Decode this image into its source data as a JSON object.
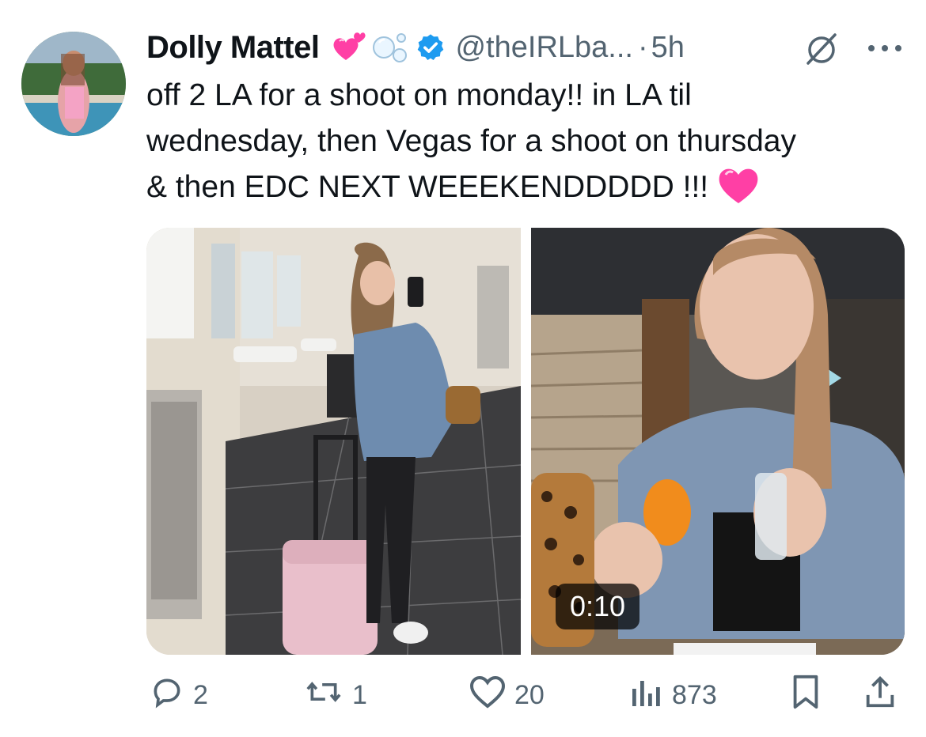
{
  "tweet": {
    "author": {
      "display_name": "Dolly Mattel",
      "handle": "@theIRLba...",
      "verified": true,
      "name_emojis": [
        "two-hearts-emoji",
        "bubbles-emoji"
      ]
    },
    "separator": "·",
    "time": "5h",
    "text_lines": [
      "off 2 LA for a shoot on monday!! in LA til",
      "wednesday, then Vegas for a shoot on thursday",
      "& then EDC NEXT WEEEKENDDDDD !!!"
    ],
    "trailing_emoji": "pink-heart-emoji",
    "media": {
      "left": "photo-airport-restroom-mirror-selfie",
      "right": "video-bar-shot-with-orange",
      "duration": "0:10"
    },
    "actions": {
      "replies": "2",
      "reposts": "1",
      "likes": "20",
      "views": "873"
    }
  },
  "colors": {
    "text": "#0f1419",
    "secondary": "#536471",
    "verified_blue": "#1d9bf0",
    "heart_pink": "#ff3fa5"
  },
  "icons": [
    "grok-icon",
    "more-icon",
    "reply-icon",
    "repost-icon",
    "like-icon",
    "views-icon",
    "bookmark-icon",
    "share-icon",
    "verified-badge-icon"
  ]
}
